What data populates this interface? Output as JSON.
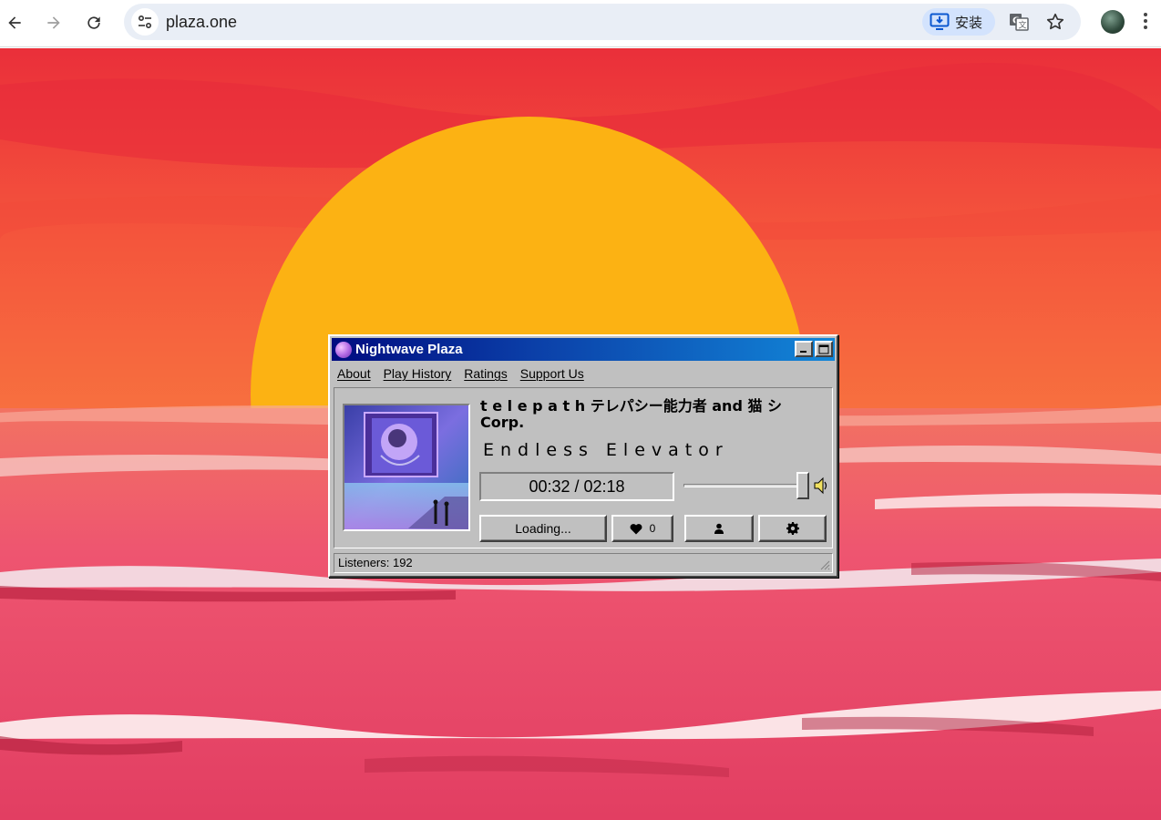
{
  "browser": {
    "url": "plaza.one",
    "install_label": "安装"
  },
  "window": {
    "title": "Nightwave Plaza",
    "menu": [
      "About",
      "Play History",
      "Ratings",
      "Support Us"
    ]
  },
  "player": {
    "artist": "t e l e p a t h テレパシー能力者 and 猫 シ Corp.",
    "song": "Endless Elevator",
    "time": "00:32 / 02:18",
    "volume": 1.0,
    "status_button": "Loading...",
    "likes": "0"
  },
  "status": {
    "listeners": "Listeners: 192"
  },
  "icons": {
    "back": "arrow-left-icon",
    "forward": "arrow-right-icon",
    "reload": "reload-icon",
    "site_info": "tune-icon",
    "install": "install-desktop-icon",
    "translate": "translate-icon",
    "bookmark": "star-icon",
    "menu": "more-vert-icon",
    "heart": "heart-icon",
    "user": "user-icon",
    "settings": "gear-icon",
    "speaker": "speaker-icon"
  },
  "colors": {
    "title_gradient_start": "#000c80",
    "title_gradient_end": "#1286d8",
    "window_face": "#c0c0c0",
    "sun": "#fcb213",
    "sky": "#f4543c",
    "sea": "#e8456a"
  }
}
